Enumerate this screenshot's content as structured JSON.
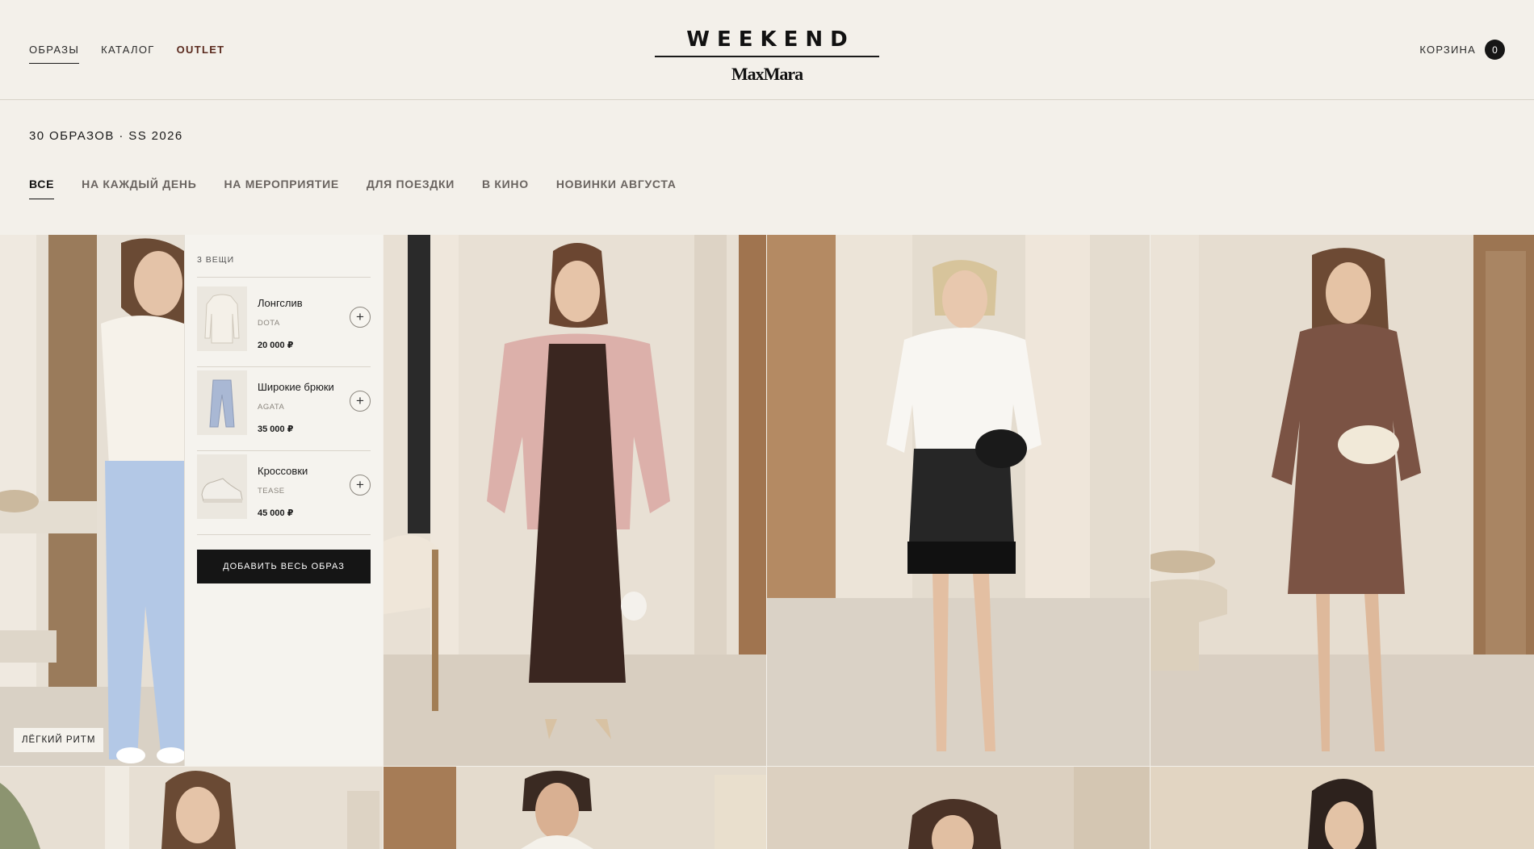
{
  "nav": {
    "items": [
      {
        "label": "ОБРАЗЫ",
        "active": true
      },
      {
        "label": "КАТАЛОГ",
        "active": false
      },
      {
        "label": "OUTLET",
        "active": false
      }
    ]
  },
  "brand": {
    "wordmark": "WEEKEND",
    "sub": "MaxMara"
  },
  "cart": {
    "label": "КОРЗИНА",
    "count": "0"
  },
  "collection": {
    "summary": "30 ОБРАЗОВ · SS 2026"
  },
  "filters": [
    {
      "label": "ВСЕ",
      "active": true
    },
    {
      "label": "НА КАЖДЫЙ ДЕНЬ",
      "active": false
    },
    {
      "label": "НА МЕРОПРИЯТИЕ",
      "active": false
    },
    {
      "label": "ДЛЯ ПОЕЗДКИ",
      "active": false
    },
    {
      "label": "В КИНО",
      "active": false
    },
    {
      "label": "НОВИНКИ АВГУСТА",
      "active": false
    }
  ],
  "look_panel": {
    "count_label": "3 ВЕЩИ",
    "items": [
      {
        "name": "Лонгслив",
        "brand": "DOTA",
        "price": "20 000 ₽",
        "icon": "longsleeve-thumb"
      },
      {
        "name": "Широкие брюки",
        "brand": "AGATA",
        "price": "35 000 ₽",
        "icon": "trousers-thumb"
      },
      {
        "name": "Кроссовки",
        "brand": "TEASE",
        "price": "45 000 ₽",
        "icon": "sneakers-thumb"
      }
    ],
    "add_all_label": "ДОБАВИТЬ ВЕСЬ ОБРАЗ"
  },
  "looks": [
    {
      "tag": "ЛЁГКИЙ РИТМ"
    }
  ],
  "colors": {
    "background": "#f3f0ea",
    "outlet": "#5a2a1e",
    "button": "#151515"
  }
}
